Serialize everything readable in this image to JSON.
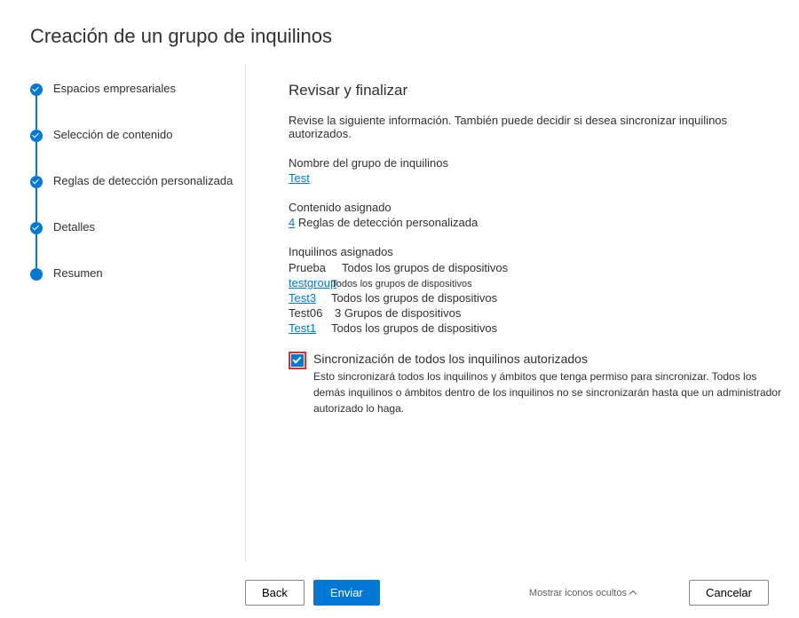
{
  "pageTitle": "Creación de un grupo de inquilinos",
  "steps": [
    {
      "label": "Espacios empresariales",
      "done": true
    },
    {
      "label": "Selección de contenido",
      "done": true
    },
    {
      "label": "Reglas de detección personalizada",
      "done": true
    },
    {
      "label": "Detalles",
      "done": true
    },
    {
      "label": "Resumen",
      "done": false
    }
  ],
  "content": {
    "title": "Revisar y finalizar",
    "description": "Revise la siguiente información. También puede decidir si desea sincronizar inquilinos autorizados.",
    "groupNameLabel": "Nombre del grupo de inquilinos",
    "groupNameValue": "Test",
    "assignedContentLabel": "Contenido asignado",
    "assignedContentCount": "4",
    "assignedContentText": "Reglas de detección personalizada",
    "assignedTenantsLabel": "Inquilinos asignados",
    "tenants": [
      {
        "name": "Prueba",
        "scope": "Todos los grupos de dispositivos",
        "link": false
      },
      {
        "name": "testgroup",
        "scope": "Todos los grupos de dispositivos",
        "link": true,
        "overlap": true
      },
      {
        "name": "Test3",
        "scope": "Todos los grupos de dispositivos",
        "link": true
      },
      {
        "name": "Test06",
        "scope": "3 Grupos de dispositivos",
        "link": false
      },
      {
        "name": "Test1",
        "scope": "Todos los grupos de dispositivos",
        "link": true
      }
    ],
    "syncTitle": "Sincronización de todos los inquilinos autorizados",
    "syncDesc": "Esto sincronizará todos los inquilinos y ámbitos que tenga permiso para sincronizar. Todos los demás inquilinos o ámbitos dentro de los inquilinos no se sincronizarán hasta que un administrador autorizado lo haga."
  },
  "footer": {
    "back": "Back",
    "submit": "Enviar",
    "showHidden": "Mostrar iconos ocultos",
    "cancel": "Cancelar"
  }
}
